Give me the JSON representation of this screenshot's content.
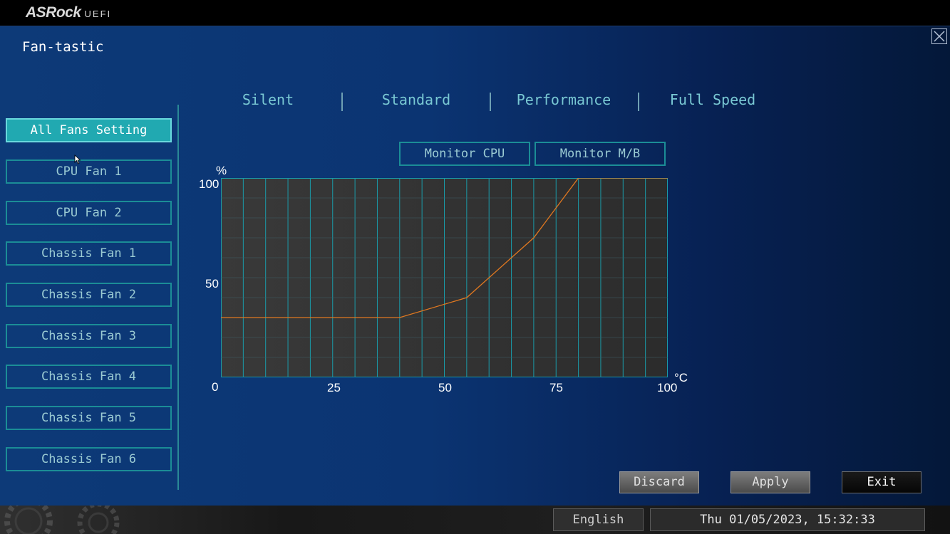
{
  "header": {
    "brand": "ASRock",
    "product": "UEFI"
  },
  "page": {
    "title": "Fan-tastic"
  },
  "sidebar": {
    "items": [
      {
        "label": "All Fans Setting",
        "active": true
      },
      {
        "label": "CPU Fan 1",
        "active": false
      },
      {
        "label": "CPU Fan 2",
        "active": false
      },
      {
        "label": "Chassis Fan 1",
        "active": false
      },
      {
        "label": "Chassis Fan 2",
        "active": false
      },
      {
        "label": "Chassis Fan 3",
        "active": false
      },
      {
        "label": "Chassis Fan 4",
        "active": false
      },
      {
        "label": "Chassis Fan 5",
        "active": false
      },
      {
        "label": "Chassis Fan 6",
        "active": false
      }
    ]
  },
  "modes": [
    {
      "label": "Silent"
    },
    {
      "label": "Standard"
    },
    {
      "label": "Performance"
    },
    {
      "label": "Full Speed"
    }
  ],
  "monitor_buttons": [
    {
      "label": "Monitor CPU"
    },
    {
      "label": "Monitor M/B"
    }
  ],
  "chart_data": {
    "type": "line",
    "ylabel": "%",
    "xlabel": "°C",
    "xlim": [
      0,
      100
    ],
    "ylim": [
      0,
      100
    ],
    "x_ticks": [
      "0",
      "25",
      "50",
      "75",
      "100"
    ],
    "y_ticks": [
      "100",
      "50"
    ],
    "grid": true,
    "series": [
      {
        "x": [
          0,
          40,
          55,
          70,
          80,
          100
        ],
        "y": [
          30,
          30,
          40,
          70,
          100,
          100
        ]
      }
    ],
    "colors": {
      "line": "#e07820",
      "grid": "#1a9aa8",
      "background": "#333333"
    }
  },
  "actions": {
    "discard": "Discard",
    "apply": "Apply",
    "exit": "Exit"
  },
  "footer": {
    "language": "English",
    "datetime": "Thu 01/05/2023, 15:32:33"
  }
}
